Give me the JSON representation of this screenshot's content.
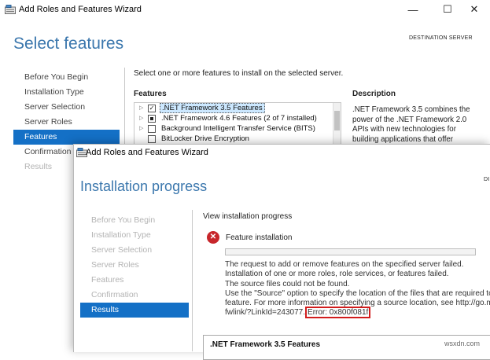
{
  "window1": {
    "title": "Add Roles and Features Wizard",
    "controls": {
      "minimize": "—",
      "maximize": "☐",
      "close": "✕"
    },
    "page_title": "Select features",
    "destination_label": "DESTINATION SERVER",
    "nav": [
      "Before You Begin",
      "Installation Type",
      "Server Selection",
      "Server Roles",
      "Features",
      "Confirmation",
      "Results"
    ],
    "instruction": "Select one or more features to install on the selected server.",
    "features_header": "Features",
    "features": [
      {
        "label": ".NET Framework 3.5 Features",
        "state": "checked"
      },
      {
        "label": ".NET Framework 4.6 Features (2 of 7 installed)",
        "state": "partial"
      },
      {
        "label": "Background Intelligent Transfer Service (BITS)",
        "state": "unchecked"
      },
      {
        "label": "BitLocker Drive Encryption",
        "state": "unchecked"
      }
    ],
    "description_header": "Description",
    "description_lines": [
      ".NET Framework 3.5 combines the",
      "power of the .NET Framework 2.0",
      "APIs with new technologies for",
      "building applications that offer"
    ]
  },
  "window2": {
    "title": "Add Roles and Features Wizard",
    "page_title": "Installation progress",
    "destination_partial": "DI",
    "nav": [
      "Before You Begin",
      "Installation Type",
      "Server Selection",
      "Server Roles",
      "Features",
      "Confirmation",
      "Results"
    ],
    "view_progress_label": "View installation progress",
    "feature_installation_label": "Feature installation",
    "details_lines": [
      "The request to add or remove features on the specified server failed.",
      "Installation of one or more roles, role services, or features failed.",
      "The source files could not be found.",
      "Use the \"Source\" option to specify the location of the files that are required to",
      "feature. For more information on specifying a source location, see http://go.mic"
    ],
    "link_fragment": "fwlink/?LinkId=243077.",
    "error_code": "Error: 0x800f081f",
    "result_feature": ".NET Framework 3.5 Features"
  },
  "watermark": "wsxdn.com",
  "colors": {
    "accent_blue": "#1470c6",
    "title_blue": "#3b77ad",
    "error_red": "#c7262b"
  }
}
